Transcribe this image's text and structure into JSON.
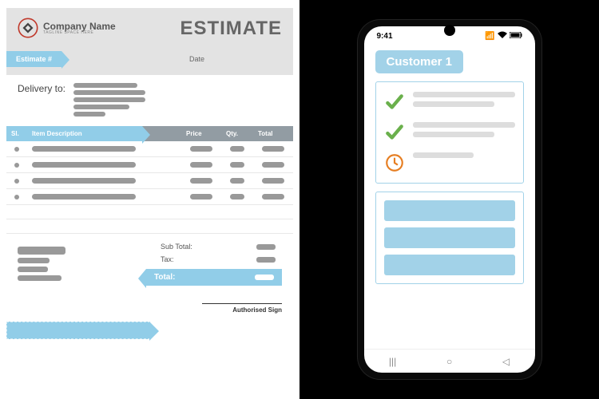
{
  "doc": {
    "company_name": "Company Name",
    "tagline": "TAGLINE SPACE HERE",
    "title": "ESTIMATE",
    "estimate_no_label": "Estimate #",
    "date_label": "Date",
    "delivery_label": "Delivery to:",
    "cols": {
      "sl": "Sl.",
      "desc": "Item Description",
      "price": "Price",
      "qty": "Qty.",
      "total": "Total"
    },
    "subtotal_label": "Sub Total:",
    "tax_label": "Tax:",
    "total_label": "Total:",
    "sign_label": "Authorised Sign"
  },
  "phone": {
    "time": "9:41",
    "customer": "Customer 1"
  }
}
